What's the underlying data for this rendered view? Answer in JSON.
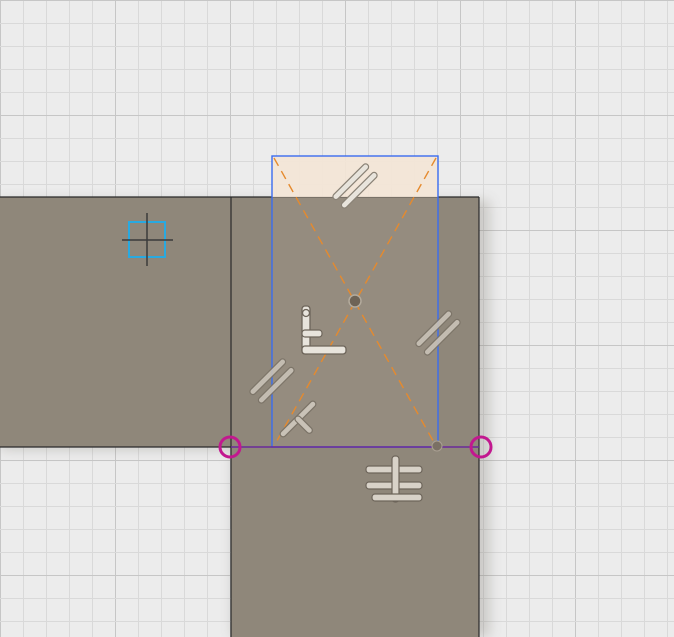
{
  "colors": {
    "background": "#ececec",
    "grid_minor": "#d9d9d9",
    "grid_major": "#c6c6c6",
    "body_fill": "#8f877a",
    "body_edge": "#2a2a2a",
    "selection_blue": "#3a6cf0",
    "selection_fill": "#f4e6d6",
    "construction_line": "#e58a2e",
    "point_marker": "#c2188f",
    "constraint_glyph": "#e8e4dc",
    "sketch_origin_box": "#29a9e0",
    "origin_cross": "#3a3a3a"
  },
  "icons": {
    "sketch_origin": "sketch-point-icon",
    "parallel_constraint": "parallel-constraint-icon",
    "perpendicular_constraint": "perpendicular-constraint-icon",
    "coincident_constraint": "coincident-constraint-icon",
    "midpoint_constraint": "midpoint-constraint-icon",
    "endpoint_marker": "endpoint-marker-icon"
  }
}
